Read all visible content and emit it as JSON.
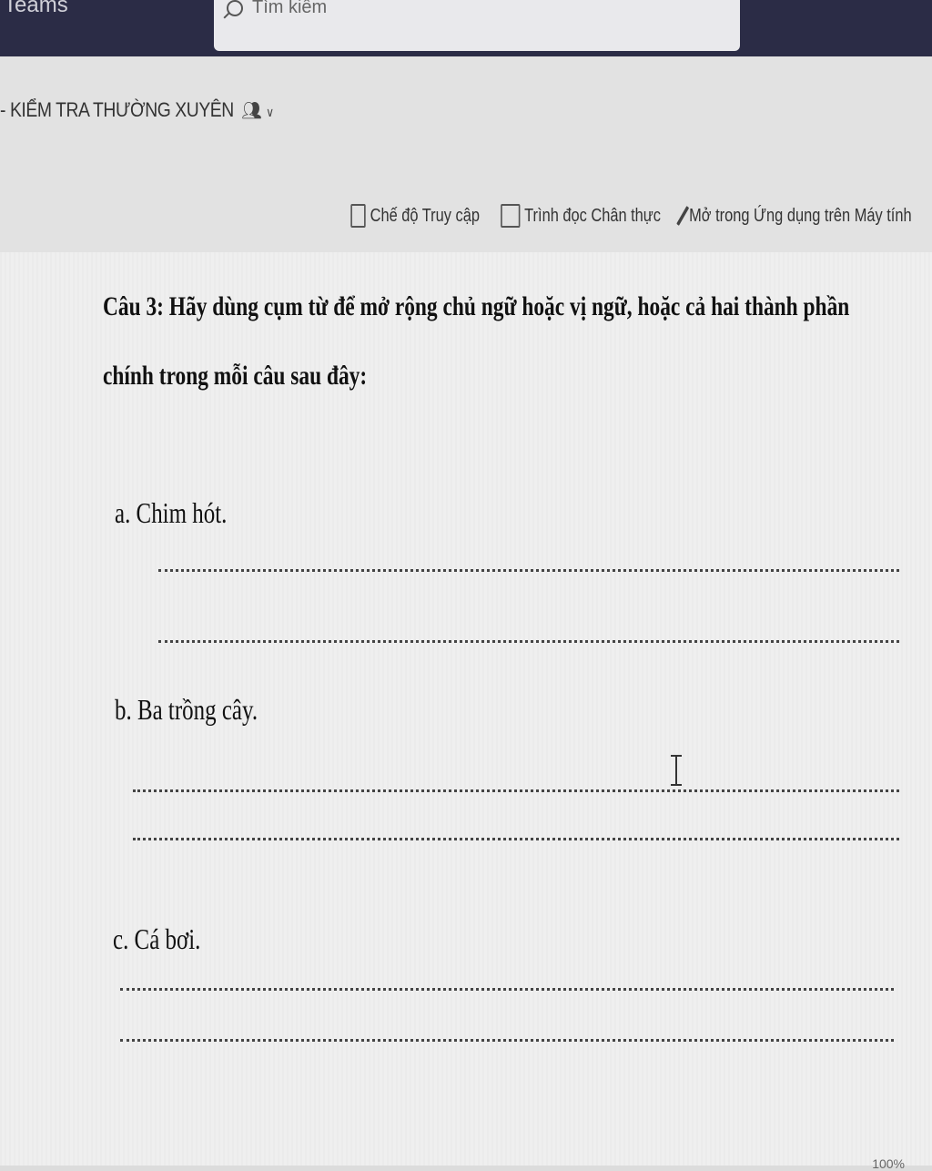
{
  "app": {
    "name": "Teams"
  },
  "search": {
    "placeholder": "Tìm kiếm"
  },
  "document": {
    "title": "- KIỂM TRA THƯỜNG XUYÊN"
  },
  "toolbar": {
    "access_mode": "Chế độ Truy cập",
    "immersive_reader": "Trình đọc Chân thực",
    "open_desktop": "Mở trong Ứng dụng trên Máy tính"
  },
  "content": {
    "question": "Câu 3: Hãy dùng cụm từ để mở rộng chủ ngữ hoặc vị ngữ, hoặc cả hai thành phần chính trong mỗi câu sau đây:",
    "items": [
      {
        "label": "a. Chim hót."
      },
      {
        "label": "b.  Ba trồng cây."
      },
      {
        "label": "c.  Cá bơi."
      }
    ]
  },
  "status": {
    "zoom": "100%"
  }
}
